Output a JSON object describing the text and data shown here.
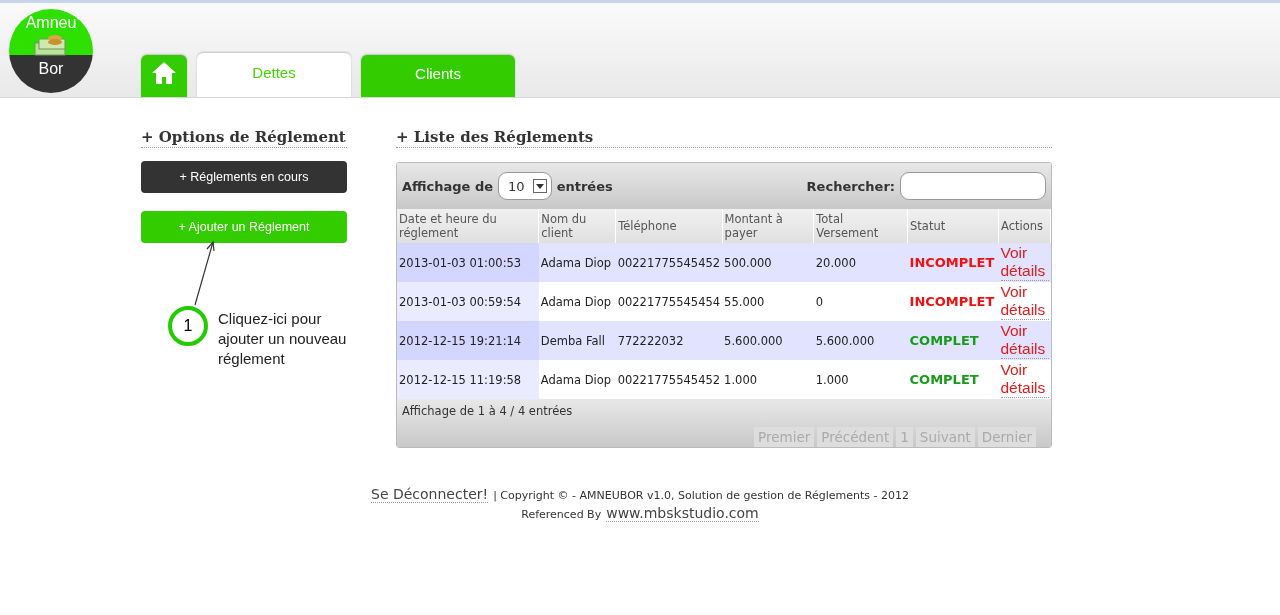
{
  "logo": {
    "top": "Amneu",
    "bottom": "Bor"
  },
  "tabs": [
    {
      "kind": "home",
      "selected": false
    },
    {
      "kind": "text",
      "label": "Dettes",
      "selected": true
    },
    {
      "kind": "text",
      "label": "Clients",
      "selected": false
    }
  ],
  "sidebar": {
    "title": "+ Options de Réglement",
    "buttons": [
      {
        "label": "+ Réglements en cours",
        "kind": "dark"
      },
      {
        "label": "+ Ajouter un Réglement",
        "kind": "green"
      }
    ],
    "callout": {
      "number": "1",
      "text": "Cliquez-ici pour ajouter un nouveau réglement"
    }
  },
  "list": {
    "title": "+ Liste des Réglements",
    "length_label_before": "Affichage de",
    "length_value": "10",
    "length_label_after": "entrées",
    "search_label": "Rechercher:",
    "table": {
      "columns": [
        "Date et heure du réglement",
        "Nom du client",
        "Téléphone",
        "Montant à payer",
        "Total Versement",
        "Statut",
        "Actions"
      ],
      "rows": [
        {
          "date": "2013-01-03 01:00:53",
          "client": "Adama Diop",
          "phone": "00221775545452",
          "amount": "500.000",
          "paid": "20.000",
          "status": "INCOMPLET",
          "complete": false,
          "action": "Voir détails"
        },
        {
          "date": "2013-01-03 00:59:54",
          "client": "Adama Diop",
          "phone": "00221775545454",
          "amount": "55.000",
          "paid": "0",
          "status": "INCOMPLET",
          "complete": false,
          "action": "Voir détails"
        },
        {
          "date": "2012-12-15 19:21:14",
          "client": "Demba Fall",
          "phone": "772222032",
          "amount": "5.600.000",
          "paid": "5.600.000",
          "status": "COMPLET",
          "complete": true,
          "action": "Voir détails"
        },
        {
          "date": "2012-12-15 11:19:58",
          "client": "Adama Diop",
          "phone": "00221775545452",
          "amount": "1.000",
          "paid": "1.000",
          "status": "COMPLET",
          "complete": true,
          "action": "Voir détails"
        }
      ]
    },
    "info": "Affichage de 1 à 4 / 4 entrées",
    "pagination": [
      "Premier",
      "Précédent",
      "1",
      "Suivant",
      "Dernier"
    ]
  },
  "footer": {
    "logout": "Se Déconnecter!",
    "copyright": "| Copyright © - AMNEUBOR v1.0, Solution de gestion de Réglements - 2012",
    "referenced": "Referenced By",
    "site": "www.mbskstudio.com"
  }
}
